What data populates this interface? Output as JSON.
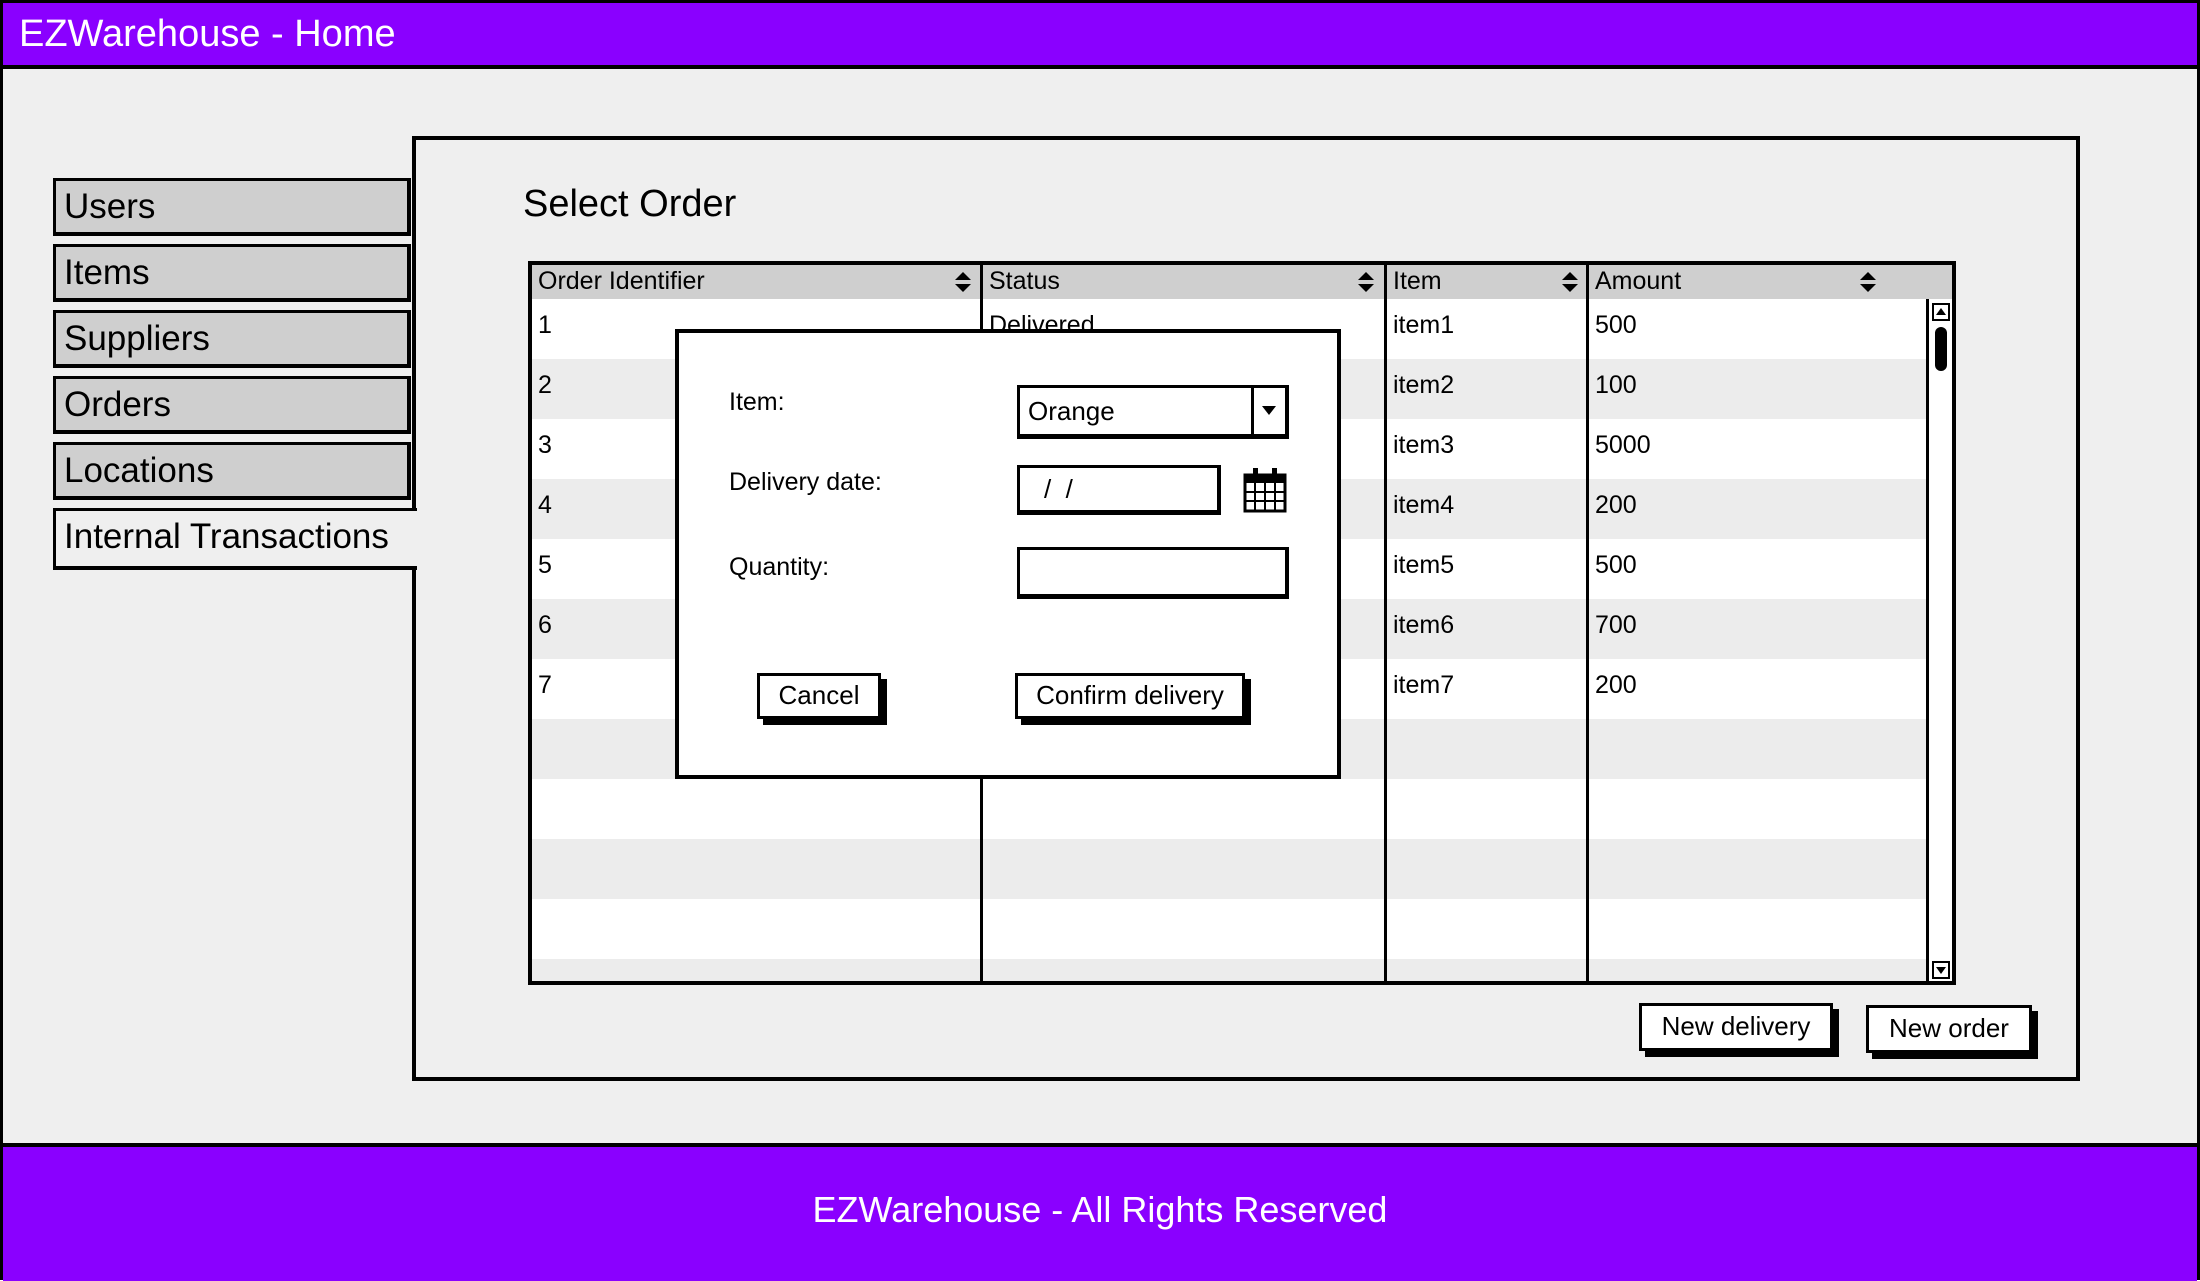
{
  "app": {
    "title": "EZWarehouse - Home",
    "footer": "EZWarehouse - All Rights Reserved"
  },
  "nav": {
    "tabs": [
      {
        "label": "Users"
      },
      {
        "label": "Items"
      },
      {
        "label": "Suppliers"
      },
      {
        "label": "Orders"
      },
      {
        "label": "Locations"
      },
      {
        "label": "Internal Transactions",
        "active": true
      }
    ]
  },
  "main": {
    "title": "Select Order",
    "columns": [
      "Order Identifier",
      "Status",
      "Item",
      "Amount"
    ],
    "rows": [
      {
        "id": "1",
        "status": "Delivered",
        "item": "item1",
        "amount": "500"
      },
      {
        "id": "2",
        "status": "",
        "item": "item2",
        "amount": "100"
      },
      {
        "id": "3",
        "status": "",
        "item": "item3",
        "amount": "5000"
      },
      {
        "id": "4",
        "status": "",
        "item": "item4",
        "amount": "200"
      },
      {
        "id": "5",
        "status": "",
        "item": "item5",
        "amount": "500"
      },
      {
        "id": "6",
        "status": "",
        "item": "item6",
        "amount": "700"
      },
      {
        "id": "7",
        "status": "",
        "item": "item7",
        "amount": "200"
      }
    ],
    "buttons": {
      "new_delivery": "New delivery",
      "new_order": "New order"
    }
  },
  "modal": {
    "item_label": "Item:",
    "item_value": "Orange",
    "date_label": "Delivery date:",
    "date_value": "/  /",
    "quantity_label": "Quantity:",
    "quantity_value": "",
    "cancel": "Cancel",
    "confirm": "Confirm delivery"
  },
  "colors": {
    "brand": "#8a00ff",
    "background": "#efefef",
    "tab": "#cfcfcf"
  },
  "icons": [
    "sort-icon",
    "calendar-icon",
    "chevron-down-icon",
    "scroll-up-icon",
    "scroll-down-icon"
  ]
}
